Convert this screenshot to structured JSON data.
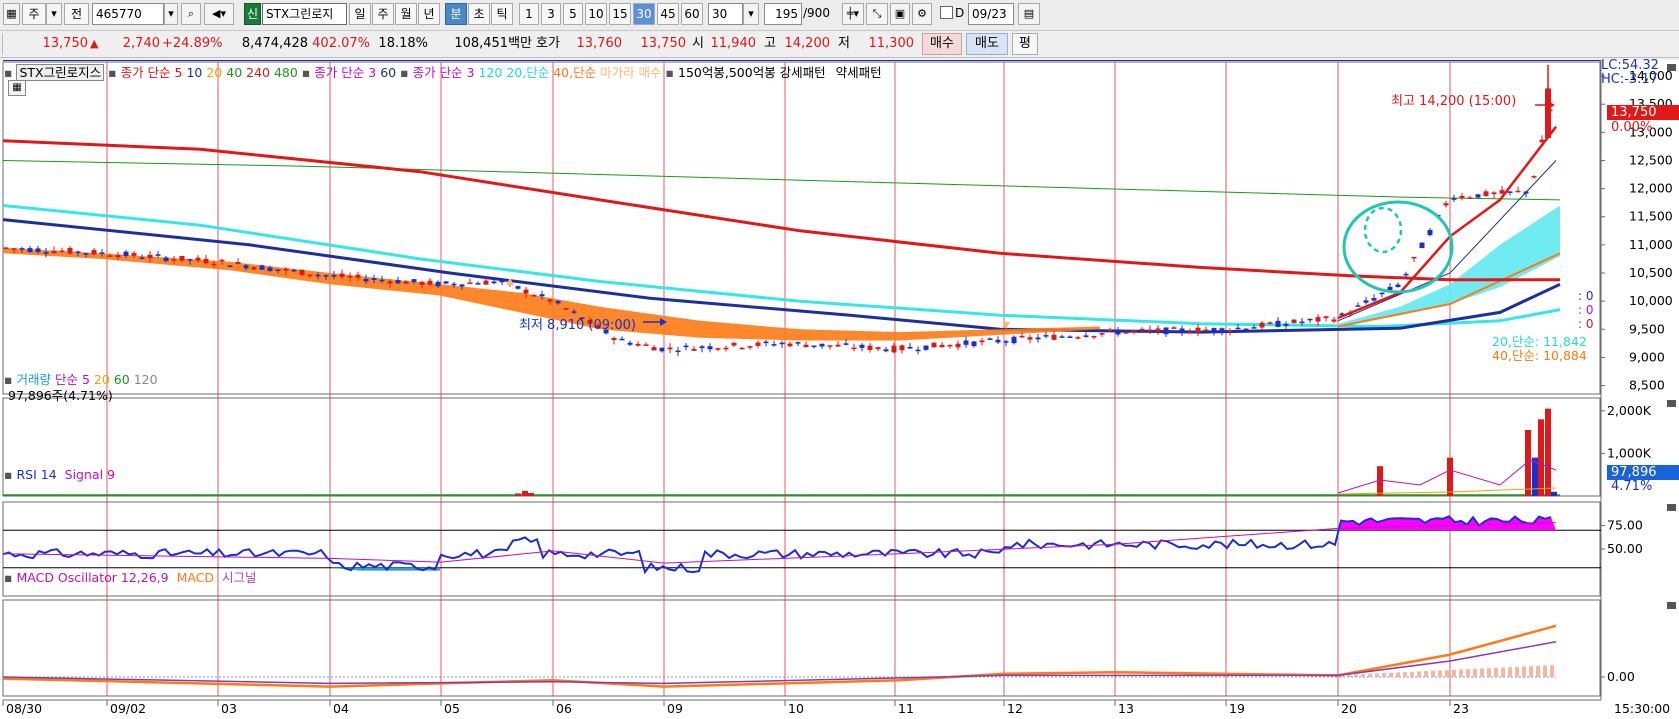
{
  "toolbar": {
    "type_label": "주",
    "jeon_label": "전",
    "code": "465770",
    "new_badge": "신",
    "stock_name": "STX그린로지",
    "period_buttons": [
      "일",
      "주",
      "월",
      "년",
      "분",
      "초",
      "틱"
    ],
    "selected_period": "분",
    "intervals": [
      "1",
      "3",
      "5",
      "10",
      "15",
      "30",
      "45",
      "60"
    ],
    "selected_interval": "30",
    "interval_select": "30",
    "count": "195",
    "count_total": "/900",
    "d_label": "D",
    "date_value": "09/23"
  },
  "quote": {
    "price": "13,750",
    "change_arrow": "▲",
    "change": "2,740",
    "change_pct": "+24.89%",
    "volume": "8,474,428",
    "vol_ratio": "402.07%",
    "turnover": "18.18%",
    "amount": "108,451백만",
    "hoga_label": "호가",
    "bid": "13,760",
    "ask": "13,750",
    "open_label": "시",
    "open": "11,940",
    "high_label": "고",
    "high": "14,200",
    "low_label": "저",
    "low": "11,300",
    "buy_label": "매수",
    "sell_label": "매도",
    "eval_label": "평"
  },
  "price_panel": {
    "legend": {
      "name": "STX그린로지스",
      "ma1_label": "종가 단순",
      "ma1_periods": [
        "5",
        "10",
        "20",
        "40",
        "240",
        "480"
      ],
      "ma2_label": "종가 단순",
      "ma2_periods": [
        "3",
        "60"
      ],
      "ma3_label": "종가 단순",
      "ma3_periods": [
        "3",
        "120",
        "20,단순",
        "40,단순"
      ],
      "signal_label": "마가라 매수",
      "pattern_label": "150억봉,500억봉 강세패턴",
      "weak_label": "약세패턴"
    },
    "lc": "LC:54.32",
    "hc": "HC:-3.17",
    "high_note": "최고 14,200 (15:00)",
    "low_note": "최저 8,910 (09:00)",
    "price_tag": "13,750",
    "pct_tag": "0.00%",
    "zero_labels": [
      ": 0",
      ": 0",
      ": 0"
    ],
    "ma20_note": "20,단순: 11,842",
    "ma40_note": "40,단순: 10,884",
    "y_ticks": [
      "14,000",
      "13,500",
      "13,000",
      "12,500",
      "12,000",
      "11,500",
      "11,000",
      "10,500",
      "10,000",
      "9,500",
      "9,000",
      "8,500"
    ]
  },
  "volume_panel": {
    "legend_name": "거래량",
    "legend_ma": "단순",
    "legend_periods": [
      "5",
      "20",
      "60",
      "120"
    ],
    "info": "97,896주(4.71%)",
    "y_ticks": [
      "2,000K",
      "1,000K"
    ],
    "vol_tag": "97,896",
    "pct_tag": "4.71%"
  },
  "rsi_panel": {
    "legend_rsi": "RSI 14",
    "legend_signal": "Signal 9",
    "y_ticks": [
      "75.00",
      "50.00"
    ]
  },
  "macd_panel": {
    "legend_osc": "MACD Oscillator 12,26,9",
    "legend_macd": "MACD",
    "legend_signal": "시그널",
    "y_ticks": [
      "0.00"
    ]
  },
  "x_axis": {
    "labels": [
      "08/30",
      "09/02",
      "03",
      "04",
      "05",
      "06",
      "09",
      "10",
      "11",
      "12",
      "13",
      "19",
      "20",
      "23"
    ],
    "time_label": "15:30:00"
  },
  "colors": {
    "up": "#e01818",
    "down": "#1a2fd0",
    "ma_red": "#e01818",
    "ma_navy": "#1c2f9c",
    "ma_cyan": "#37e6e6",
    "fill_orange": "#ff7a14",
    "rsi_fill": "#ff00ff"
  }
}
